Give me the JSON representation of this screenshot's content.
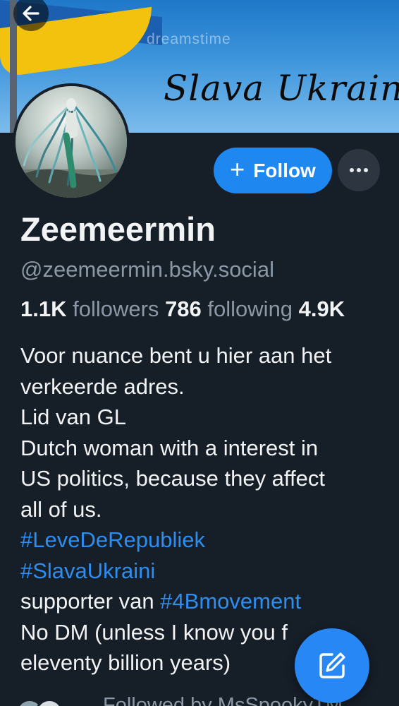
{
  "banner": {
    "script_text": "Slava Ukrain",
    "watermark": "dreamstime",
    "colors": {
      "sky": "#3d95dc",
      "flag_blue": "#1c5fb0",
      "flag_yellow": "#f3c20f"
    }
  },
  "header": {
    "back_icon": "arrow-left-icon"
  },
  "actions": {
    "follow_label": "Follow",
    "follow_icon": "plus-icon",
    "more_icon": "ellipsis-icon"
  },
  "profile": {
    "display_name": "Zeemeermin",
    "handle": "@zeemeermin.bsky.social",
    "stats": {
      "followers_count": "1.1K",
      "followers_label": "followers",
      "following_count": "786",
      "following_label": "following",
      "posts_count": "4.9K"
    },
    "bio": {
      "line1": "Voor nuance bent u hier aan het",
      "line2": "verkeerde adres.",
      "line3": "Lid van GL",
      "line4": "Dutch woman with a interest in",
      "line5": "US politics, because they affect",
      "line6": "all of us.",
      "hashtag1": "#LeveDeRepubliek",
      "hashtag2": "#SlavaUkraini",
      "line9_prefix": "supporter van ",
      "hashtag3": "#4Bmovement",
      "line10": "No DM (unless I know you f",
      "line11": "eleventy billion years)"
    },
    "followed_by": "Followed by MsSpookyTM"
  },
  "fab": {
    "compose_icon": "compose-icon"
  },
  "theme": {
    "background": "#161e27",
    "accent": "#1e87f0",
    "text_primary": "#f1f3f5",
    "text_secondary": "#8c98a6",
    "link": "#2d8ef0"
  }
}
